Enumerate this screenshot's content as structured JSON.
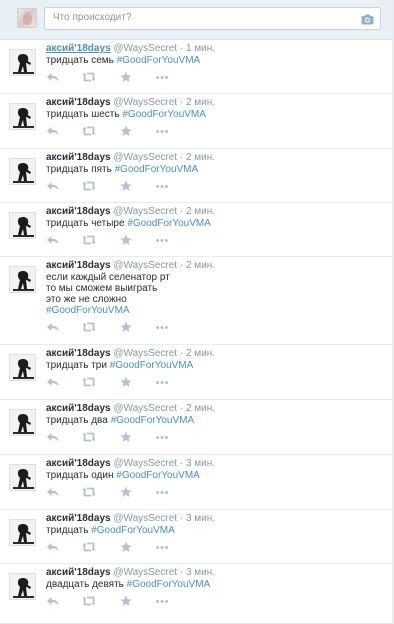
{
  "compose": {
    "placeholder": "Что происходит?",
    "avatar_icon": "user-avatar",
    "camera_icon": "camera-icon"
  },
  "colors": {
    "link": "#4a90c8",
    "muted": "#8899a6",
    "compose_bg": "#e8f0f6"
  },
  "tweets": [
    {
      "fullname": "аксий'18days",
      "username": "@WaysSecret",
      "time": "1 мин.",
      "text": "тридцать семь ",
      "hashtag": "#GoodForYouVMA"
    },
    {
      "fullname": "аксий'18days",
      "username": "@WaysSecret",
      "time": "2 мин.",
      "text": "тридцать шесть ",
      "hashtag": "#GoodForYouVMA"
    },
    {
      "fullname": "аксий'18days",
      "username": "@WaysSecret",
      "time": "2 мин.",
      "text": "тридцать пять ",
      "hashtag": "#GoodForYouVMA"
    },
    {
      "fullname": "аксий'18days",
      "username": "@WaysSecret",
      "time": "2 мин.",
      "text": "тридцать четыре ",
      "hashtag": "#GoodForYouVMA"
    },
    {
      "fullname": "аксий'18days",
      "username": "@WaysSecret",
      "time": "2 мин.",
      "text": "если каждый селенатор рт\nто мы сможем выиграть\nэто же не сложно\n",
      "hashtag": "#GoodForYouVMA"
    },
    {
      "fullname": "аксий'18days",
      "username": "@WaysSecret",
      "time": "2 мин.",
      "text": "тридцать три ",
      "hashtag": "#GoodForYouVMA"
    },
    {
      "fullname": "аксий'18days",
      "username": "@WaysSecret",
      "time": "2 мин.",
      "text": "тридцать два ",
      "hashtag": "#GoodForYouVMA"
    },
    {
      "fullname": "аксий'18days",
      "username": "@WaysSecret",
      "time": "3 мин.",
      "text": "тридцать один ",
      "hashtag": "#GoodForYouVMA"
    },
    {
      "fullname": "аксий'18days",
      "username": "@WaysSecret",
      "time": "3 мин.",
      "text": "тридцать ",
      "hashtag": "#GoodForYouVMA"
    },
    {
      "fullname": "аксий'18days",
      "username": "@WaysSecret",
      "time": "3 мин.",
      "text": "двадцать девять ",
      "hashtag": "#GoodForYouVMA"
    }
  ],
  "actions": {
    "reply_icon": "reply-icon",
    "retweet_icon": "retweet-icon",
    "favorite_icon": "star-icon",
    "more_icon": "more-icon"
  }
}
